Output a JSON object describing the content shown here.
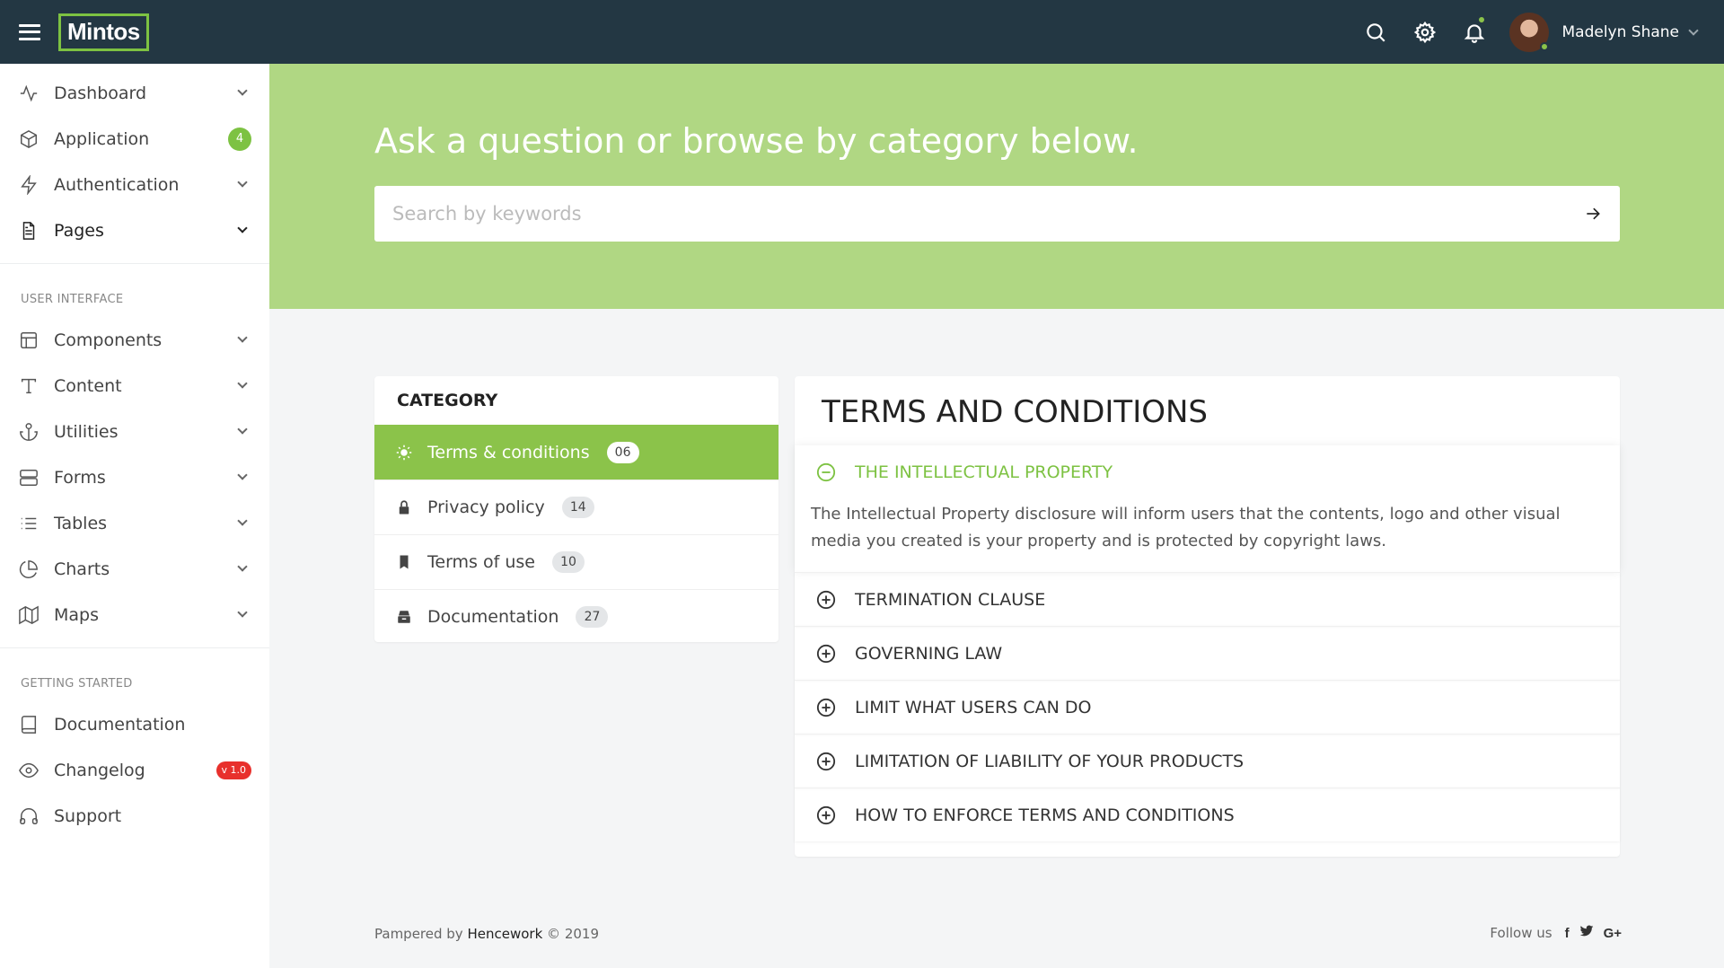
{
  "topbar": {
    "logo": "Mintos",
    "user_name": "Madelyn Shane"
  },
  "sidebar": {
    "main": [
      {
        "label": "Dashboard",
        "icon": "activity-icon",
        "caret": true
      },
      {
        "label": "Application",
        "icon": "box-icon",
        "badge": "4"
      },
      {
        "label": "Authentication",
        "icon": "zap-icon",
        "caret": true
      },
      {
        "label": "Pages",
        "icon": "file-icon",
        "caret": true
      }
    ],
    "ui_title": "USER INTERFACE",
    "ui": [
      {
        "label": "Components",
        "icon": "layout-icon"
      },
      {
        "label": "Content",
        "icon": "type-icon"
      },
      {
        "label": "Utilities",
        "icon": "anchor-icon"
      },
      {
        "label": "Forms",
        "icon": "server-icon"
      },
      {
        "label": "Tables",
        "icon": "list-icon"
      },
      {
        "label": "Charts",
        "icon": "pie-chart-icon"
      },
      {
        "label": "Maps",
        "icon": "map-icon"
      }
    ],
    "gs_title": "GETTING STARTED",
    "gs": [
      {
        "label": "Documentation",
        "icon": "book-icon"
      },
      {
        "label": "Changelog",
        "icon": "eye-icon",
        "badge": "v 1.0"
      },
      {
        "label": "Support",
        "icon": "headphones-icon"
      }
    ]
  },
  "hero": {
    "title": "Ask a question or browse by category below.",
    "search_placeholder": "Search by keywords"
  },
  "category": {
    "title": "CATEGORY",
    "items": [
      {
        "label": "Terms & conditions",
        "count": "06",
        "icon": "sun-icon",
        "active": true
      },
      {
        "label": "Privacy policy",
        "count": "14",
        "icon": "lock-icon"
      },
      {
        "label": "Terms of use",
        "count": "10",
        "icon": "bookmark-icon"
      },
      {
        "label": "Documentation",
        "count": "27",
        "icon": "archive-icon"
      }
    ]
  },
  "terms": {
    "title": "TERMS AND CONDITIONS",
    "open_item": {
      "heading": "THE INTELLECTUAL PROPERTY",
      "body": "The Intellectual Property disclosure will inform users that the contents, logo and other visual media you created is your property and is protected by copyright laws."
    },
    "items": [
      "TERMINATION CLAUSE",
      "GOVERNING LAW",
      "LIMIT WHAT USERS CAN DO",
      "LIMITATION OF LIABILITY OF YOUR PRODUCTS",
      "HOW TO ENFORCE TERMS AND CONDITIONS"
    ]
  },
  "footer": {
    "pampered_by": "Pampered by",
    "brand": "Hencework",
    "copyright": "© 2019",
    "follow": "Follow us",
    "social": [
      "f",
      "twitter",
      "G+"
    ]
  },
  "colors": {
    "topbar": "#233743",
    "accent": "#8bc34a",
    "hero": "#b0d783",
    "badge_red": "#e8302c"
  }
}
